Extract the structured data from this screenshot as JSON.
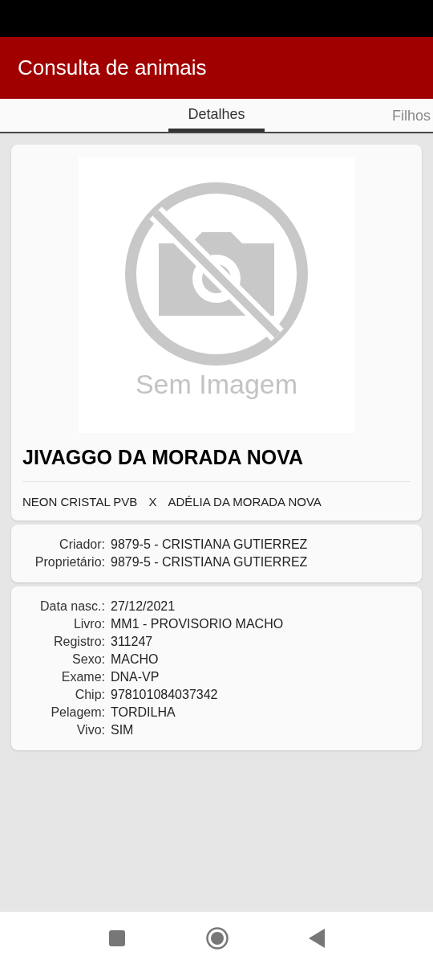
{
  "app_bar": {
    "title": "Consulta de animais"
  },
  "tabs": [
    {
      "label": "Detalhes",
      "selected": true
    },
    {
      "label": "Filhos",
      "selected": false
    }
  ],
  "photo": {
    "caption": "Sem Imagem"
  },
  "animal": {
    "name": "JIVAGGO DA MORADA NOVA",
    "sire": "NEON CRISTAL PVB",
    "cross": "X",
    "dam": "ADÉLIA DA MORADA NOVA"
  },
  "ownership": [
    {
      "label": "Criador:",
      "value": "9879-5 - CRISTIANA GUTIERREZ"
    },
    {
      "label": "Proprietário:",
      "value": "9879-5 - CRISTIANA GUTIERREZ"
    }
  ],
  "details": [
    {
      "label": "Data nasc.:",
      "value": "27/12/2021"
    },
    {
      "label": "Livro:",
      "value": "MM1 - PROVISORIO MACHO"
    },
    {
      "label": "Registro:",
      "value": "311247"
    },
    {
      "label": "Sexo:",
      "value": "MACHO"
    },
    {
      "label": "Exame:",
      "value": "DNA-VP"
    },
    {
      "label": "Chip:",
      "value": "978101084037342"
    },
    {
      "label": "Pelagem:",
      "value": "TORDILHA"
    },
    {
      "label": "Vivo:",
      "value": "SIM"
    }
  ]
}
